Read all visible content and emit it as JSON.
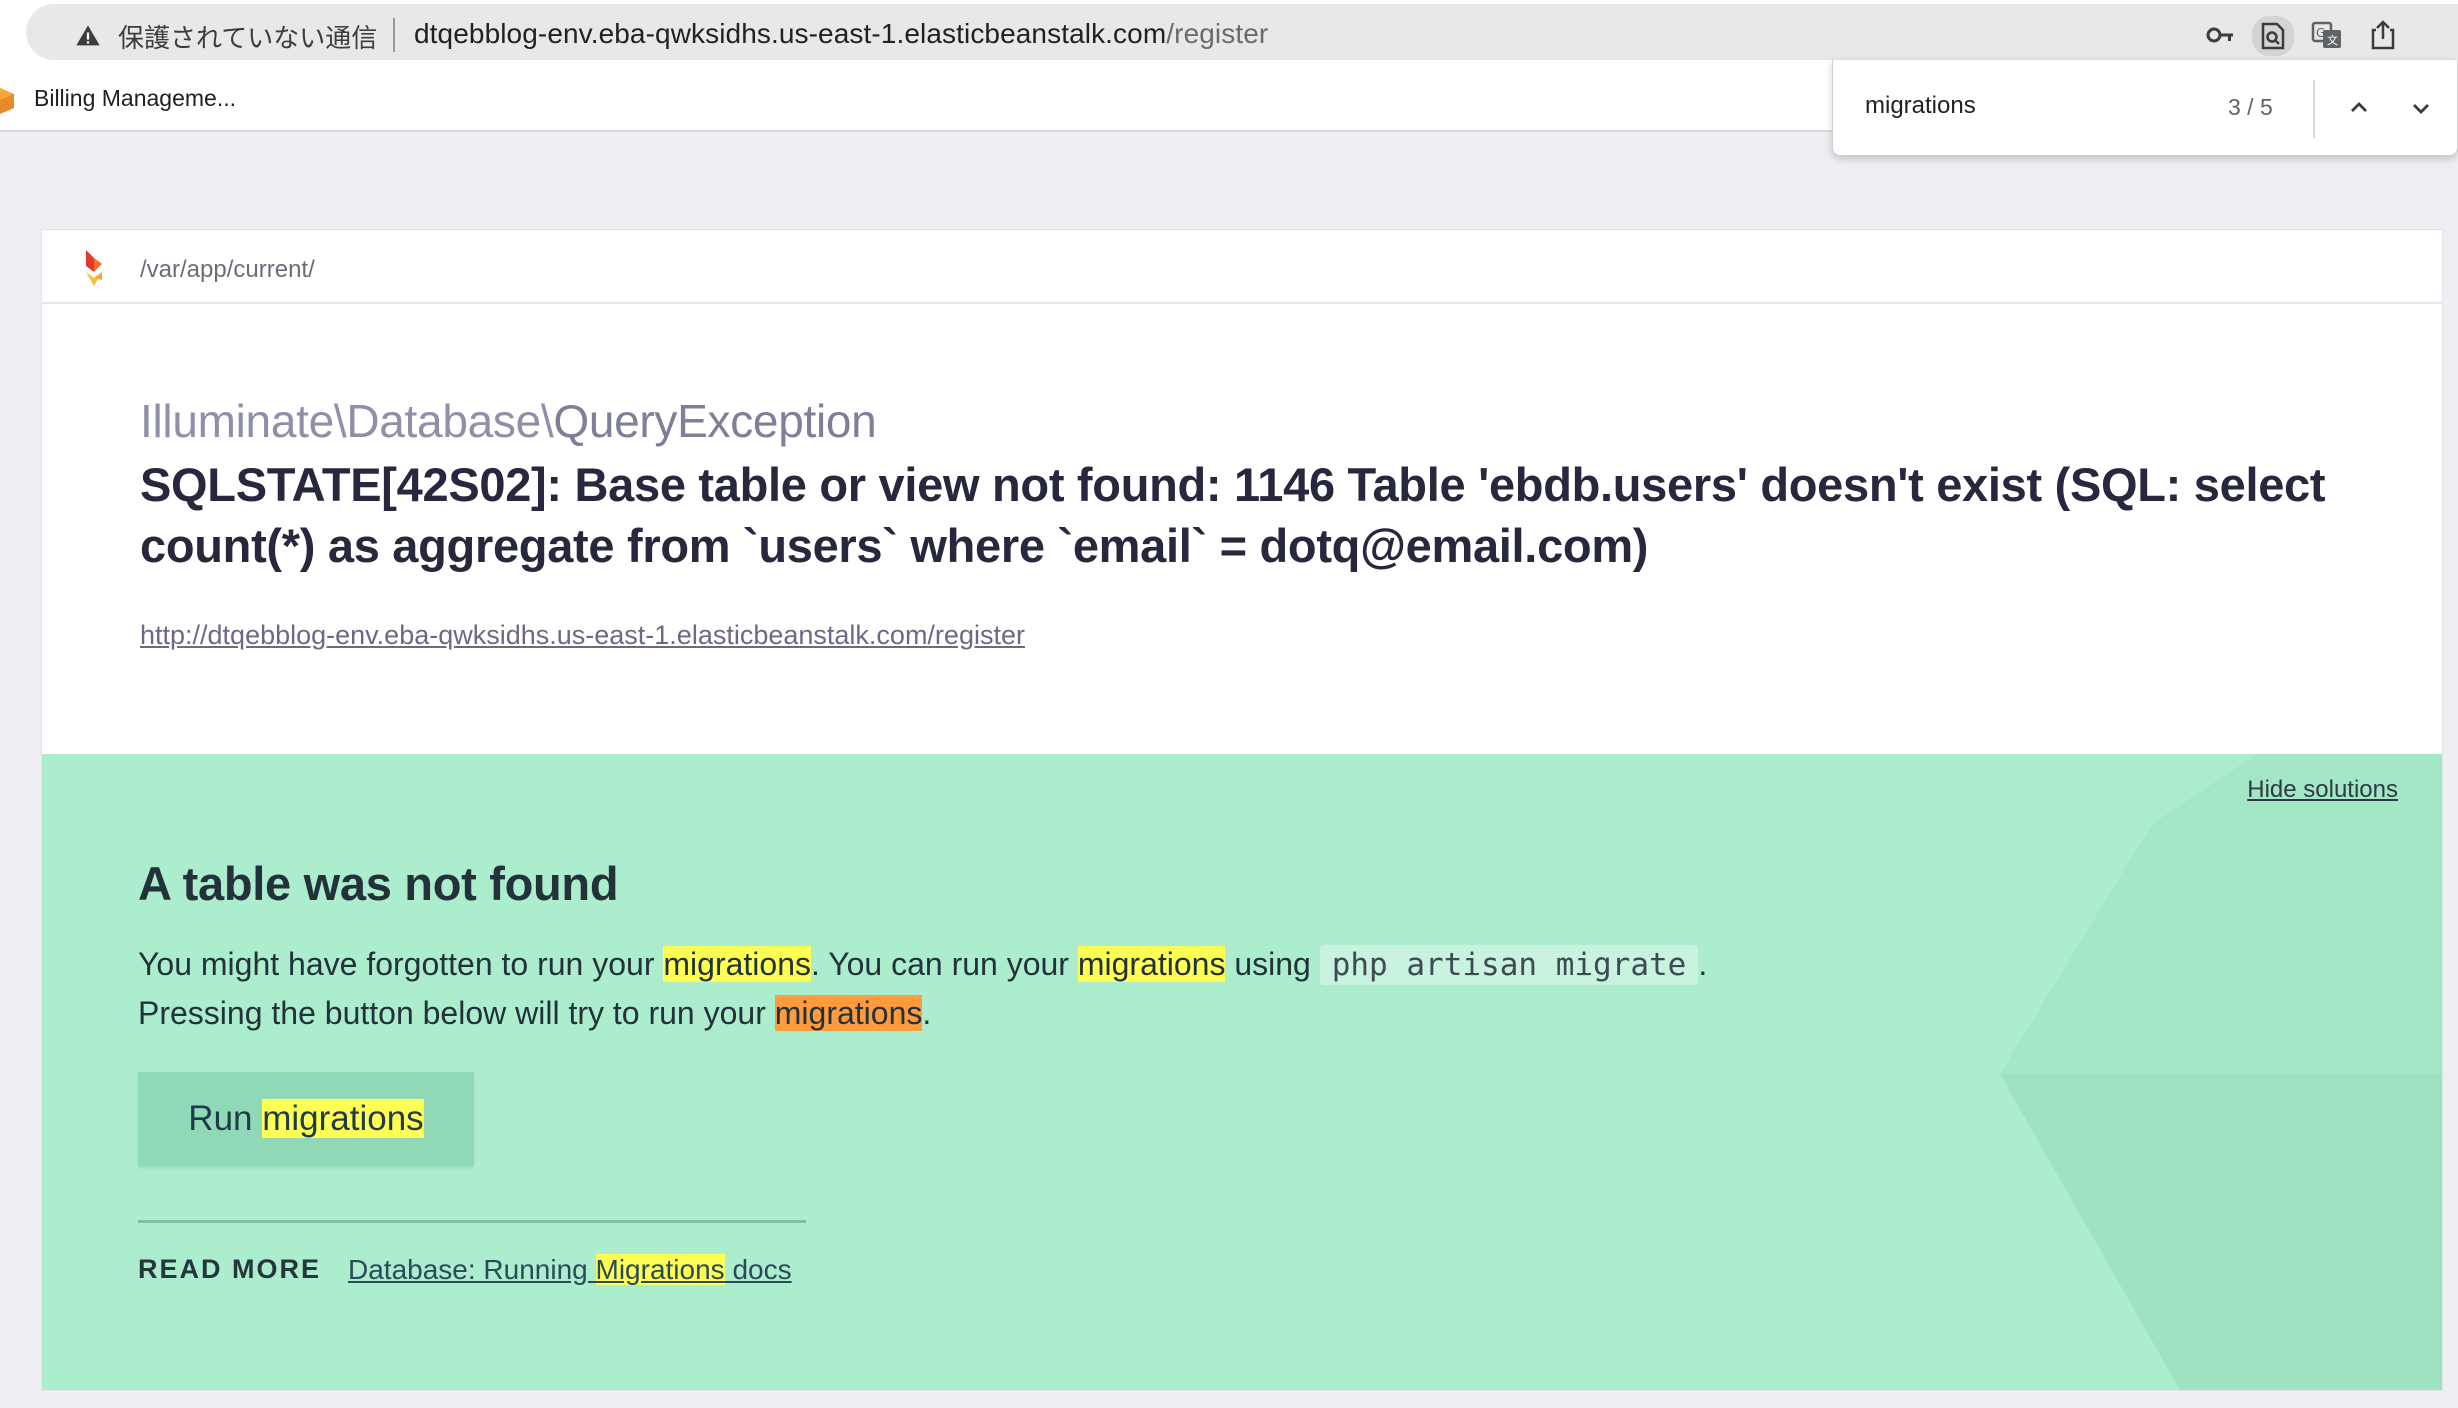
{
  "browser": {
    "security_text": "保護されていない通信",
    "url_host": "dtqebblog-env.eba-qwksidhs.us-east-1.elasticbeanstalk.com",
    "url_path": "/register",
    "icons": [
      "warning-icon",
      "key-icon",
      "find-in-page-icon",
      "translate-icon",
      "share-icon"
    ]
  },
  "bookmarks": {
    "items": [
      {
        "label": "Billing Manageme..."
      }
    ]
  },
  "find_bar": {
    "query": "migrations",
    "count": "3 / 5"
  },
  "page": {
    "app_path": "/var/app/current/",
    "exception_prefix": "Illuminate\\Database\\",
    "exception_class": "QueryException",
    "message": "SQLSTATE[42S02]: Base table or view not found: 1146 Table 'ebdb.users' doesn't exist (SQL: select count(*) as aggregate from `users` where `email` = dotq@email.com)",
    "url": "http://dtqebblog-env.eba-qwksidhs.us-east-1.elasticbeanstalk.com/register"
  },
  "solution": {
    "hide_label": "Hide solutions",
    "title": "A table was not found",
    "line1_a": "You might have forgotten to run your ",
    "highlight_word": "migrations",
    "line1_b": ". You can run your ",
    "line1_c": " using ",
    "command": "php artisan migrate",
    "line1_d": ".",
    "line2_a": "Pressing the button below will try to run your ",
    "line2_b": ".",
    "button_prefix": "Run ",
    "button_highlight": "migrations",
    "read_more_label": "READ MORE",
    "doc_link_a": "Database: Running ",
    "doc_link_highlight": "Migrations",
    "doc_link_b": " docs"
  },
  "colors": {
    "solution_bg": "#abedcd",
    "highlight": "#ffff54",
    "current_highlight": "#ff9b3c"
  }
}
